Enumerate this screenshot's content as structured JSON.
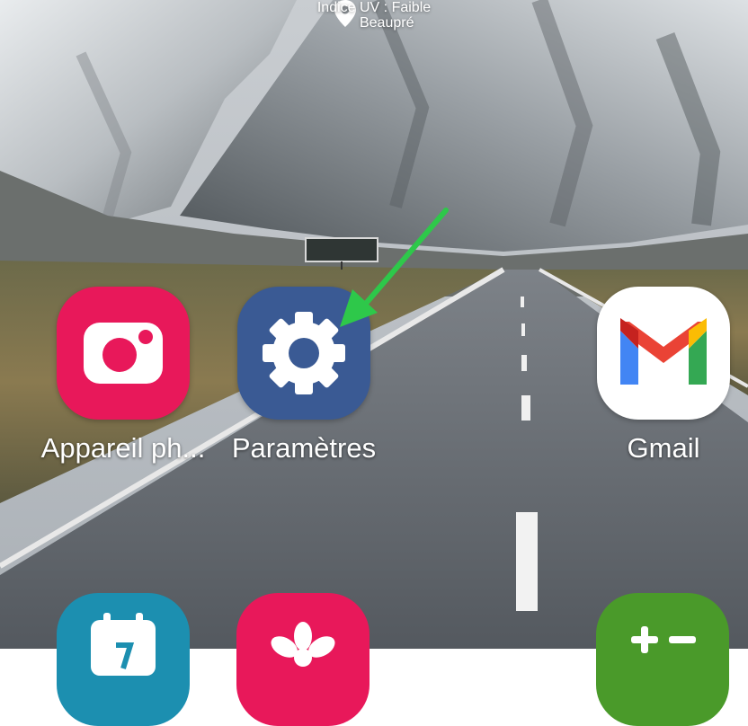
{
  "weather": {
    "location": "Beaupré",
    "uv_index": "Indice UV : Faible"
  },
  "apps": [
    {
      "label": "Appareil ph...",
      "icon": "camera-icon",
      "color": "#e8185a"
    },
    {
      "label": "Paramètres",
      "icon": "gear-icon",
      "color": "#3a5a94"
    },
    {
      "label": "Gmail",
      "icon": "gmail-icon",
      "color": "#ffffff"
    }
  ],
  "dock_partial": [
    {
      "icon": "calendar-icon",
      "color": "#1c8fb0"
    },
    {
      "icon": "bixby-flower-icon",
      "color": "#e8185a"
    },
    {
      "icon": "calculator-icon",
      "color": "#4a9a2a"
    }
  ],
  "annotation": {
    "arrow_color": "#2ec84a"
  }
}
